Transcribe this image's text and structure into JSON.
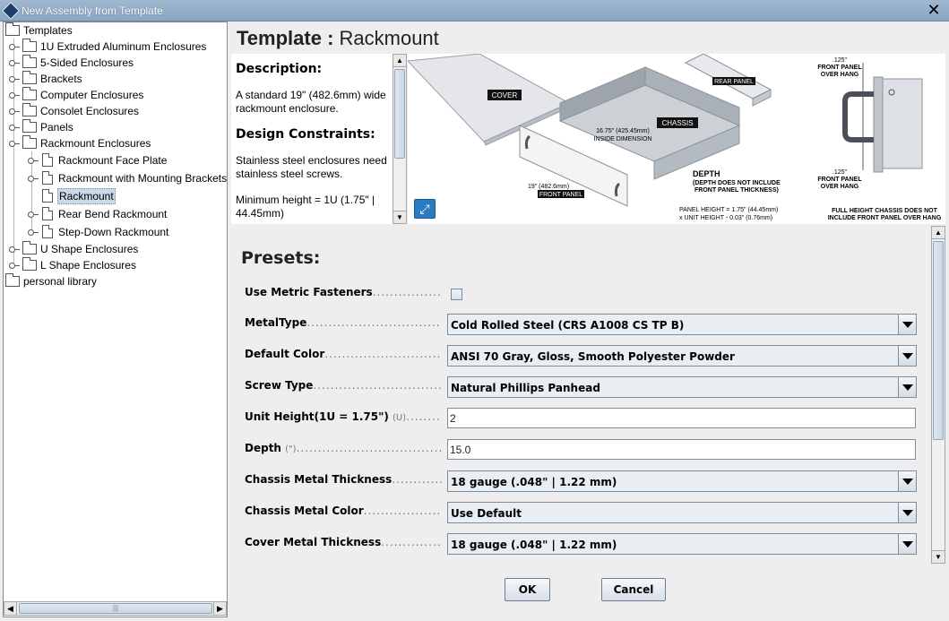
{
  "window": {
    "title": "New Assembly from Template",
    "close_glyph": "✕"
  },
  "tree": {
    "root_label": "Templates",
    "items": [
      {
        "label": "1U Extruded Aluminum Enclosures",
        "kind": "folder"
      },
      {
        "label": "5-Sided Enclosures",
        "kind": "folder"
      },
      {
        "label": "Brackets",
        "kind": "folder"
      },
      {
        "label": "Computer Enclosures",
        "kind": "folder"
      },
      {
        "label": "Consolet Enclosures",
        "kind": "folder"
      },
      {
        "label": "Panels",
        "kind": "folder"
      },
      {
        "label": "Rackmount Enclosures",
        "kind": "folder",
        "expanded": true
      },
      {
        "label": "Rackmount Face Plate",
        "kind": "document"
      },
      {
        "label": "Rackmount with Mounting Brackets",
        "kind": "document"
      },
      {
        "label": "Rackmount",
        "kind": "document",
        "selected": true
      },
      {
        "label": "Rear Bend Rackmount",
        "kind": "document"
      },
      {
        "label": "Step-Down Rackmount",
        "kind": "document"
      },
      {
        "label": "U Shape Enclosures",
        "kind": "folder"
      },
      {
        "label": "L Shape Enclosures",
        "kind": "folder"
      }
    ],
    "personal_library": "personal library"
  },
  "template": {
    "heading_prefix": "Template :",
    "heading_name": "Rackmount",
    "description_title": "Description:",
    "description_text": "A standard 19\" (482.6mm) wide rackmount enclosure.",
    "constraints_title": "Design Constraints:",
    "constraint_1": "Stainless steel enclosures need stainless steel screws.",
    "constraint_2": "Minimum height = 1U (1.75\" | 44.45mm)"
  },
  "diagram_labels": {
    "cover": "COVER",
    "rear_panel": "REAR PANEL",
    "chassis": "CHASSIS",
    "inside_dim_1": "16.75\" (425.45mm)",
    "inside_dim_2": "INSIDE DIMENSION",
    "front_width_1": "19\" (482.6mm)",
    "front_width_2": "FRONT PANEL",
    "depth_1": "DEPTH",
    "depth_2": "(DEPTH DOES NOT INCLUDE",
    "depth_3": "FRONT PANEL THICKNESS)",
    "panel_height_1": "PANEL HEIGHT = 1.75\" (44.45mm)",
    "panel_height_2": "x UNIT HEIGHT - 0.03\" (0.76mm)",
    "overhang_top_1": ".125\"",
    "overhang_top_2": "FRONT PANEL",
    "overhang_top_3": "OVER HANG",
    "overhang_bot_1": ".125\"",
    "overhang_bot_2": "FRONT PANEL",
    "overhang_bot_3": "OVER HANG",
    "full_height_1": "FULL HEIGHT CHASSIS DOES NOT",
    "full_height_2": "INCLUDE FRONT PANEL OVER HANG",
    "expand_glyph": "⤢"
  },
  "presets": {
    "title": "Presets:",
    "fields": {
      "use_metric": {
        "label": "Use Metric Fasteners",
        "checked": false
      },
      "metal_type": {
        "label": "MetalType",
        "value": "Cold Rolled Steel (CRS A1008 CS TP B)"
      },
      "default_color": {
        "label": "Default Color",
        "value": "ANSI 70 Gray, Gloss, Smooth Polyester Powder"
      },
      "screw_type": {
        "label": "Screw Type",
        "value": "Natural Phillips Panhead"
      },
      "unit_height": {
        "label": "Unit Height(1U = 1.75\")",
        "unit": "(U)",
        "value": "2"
      },
      "depth": {
        "label": "Depth",
        "unit": "(\")",
        "value": "15.0"
      },
      "chassis_thickness": {
        "label": "Chassis Metal Thickness",
        "value": "18 gauge (.048\" | 1.22 mm)"
      },
      "chassis_color": {
        "label": "Chassis Metal Color",
        "value": "Use Default"
      },
      "cover_thickness": {
        "label": "Cover Metal Thickness",
        "value": "18 gauge (.048\" | 1.22 mm)"
      }
    }
  },
  "buttons": {
    "ok": "OK",
    "cancel": "Cancel"
  },
  "scroll_glyphs": {
    "up": "▲",
    "down": "▼",
    "left": "◀",
    "right": "▶",
    "grip_h": "|||",
    "grip_v": "≡"
  }
}
